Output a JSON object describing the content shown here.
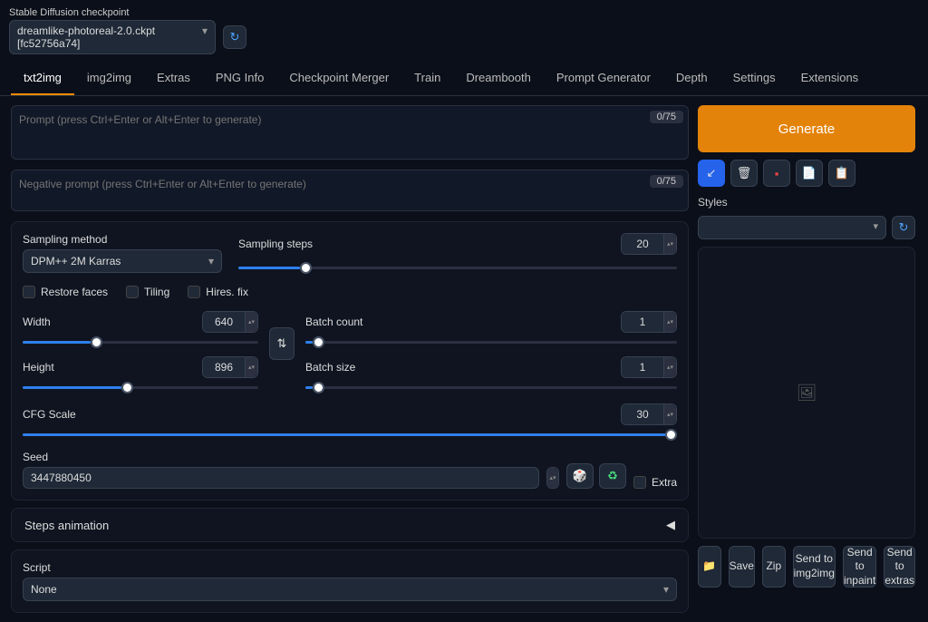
{
  "checkpoint": {
    "label": "Stable Diffusion checkpoint",
    "value": "dreamlike-photoreal-2.0.ckpt [fc52756a74]"
  },
  "tabs": [
    "txt2img",
    "img2img",
    "Extras",
    "PNG Info",
    "Checkpoint Merger",
    "Train",
    "Dreambooth",
    "Prompt Generator",
    "Depth",
    "Settings",
    "Extensions"
  ],
  "active_tab": 0,
  "prompt": {
    "placeholder": "Prompt (press Ctrl+Enter or Alt+Enter to generate)",
    "counter": "0/75"
  },
  "neg_prompt": {
    "placeholder": "Negative prompt (press Ctrl+Enter or Alt+Enter to generate)",
    "counter": "0/75"
  },
  "generate_label": "Generate",
  "styles_label": "Styles",
  "sampling": {
    "method_label": "Sampling method",
    "method_value": "DPM++ 2M Karras",
    "steps_label": "Sampling steps",
    "steps_value": 20
  },
  "checks": {
    "restore": "Restore faces",
    "tiling": "Tiling",
    "hires": "Hires. fix"
  },
  "dims": {
    "width_label": "Width",
    "width_value": 640,
    "height_label": "Height",
    "height_value": 896
  },
  "batch": {
    "count_label": "Batch count",
    "count_value": 1,
    "size_label": "Batch size",
    "size_value": 1
  },
  "cfg": {
    "label": "CFG Scale",
    "value": 30
  },
  "seed": {
    "label": "Seed",
    "value": "3447880450",
    "extra_label": "Extra"
  },
  "accordion": "Steps animation",
  "script": {
    "label": "Script",
    "value": "None"
  },
  "actions": {
    "save": "Save",
    "zip": "Zip",
    "img2img": "Send to img2img",
    "inpaint": "Send to inpaint",
    "extras": "Send to extras"
  }
}
